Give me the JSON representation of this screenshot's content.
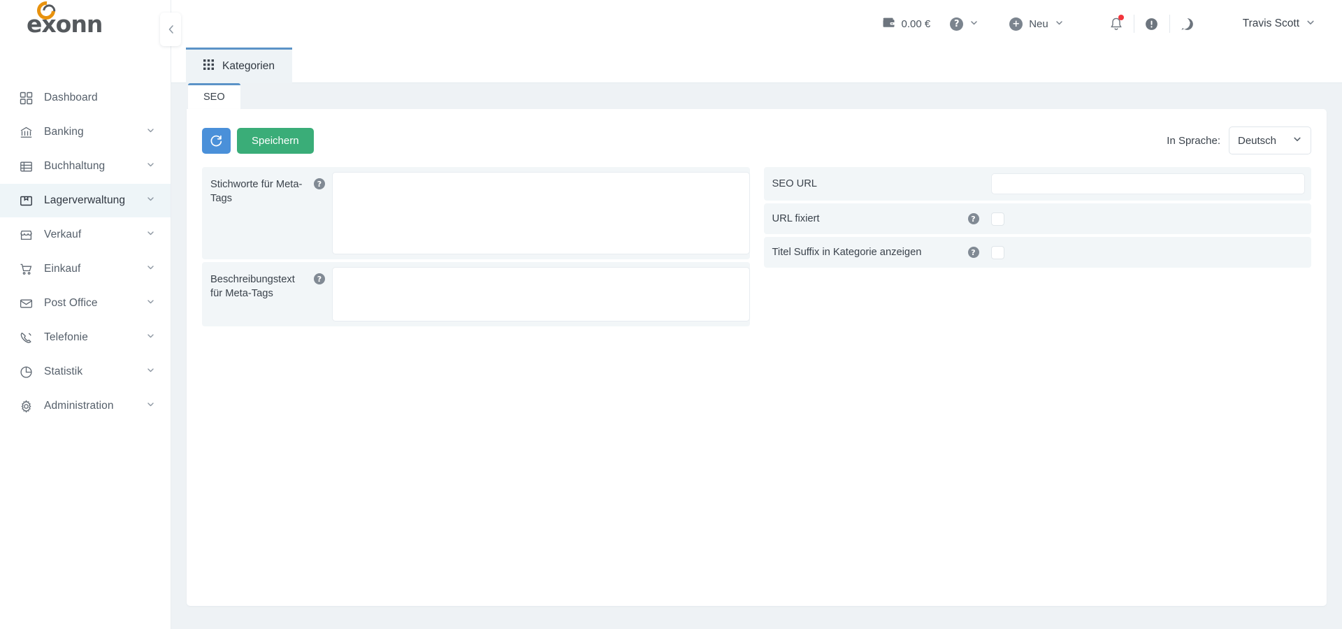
{
  "brand": {
    "logo_text": "exonn",
    "accent_color": "#e8920e"
  },
  "sidebar": {
    "collapse_icon": "chevron-left-icon",
    "items": [
      {
        "label": "Dashboard",
        "icon": "grid-icon",
        "has_chevron": false,
        "active": false
      },
      {
        "label": "Banking",
        "icon": "bank-icon",
        "has_chevron": true,
        "active": false
      },
      {
        "label": "Buchhaltung",
        "icon": "ledger-icon",
        "has_chevron": true,
        "active": false
      },
      {
        "label": "Lagerverwaltung",
        "icon": "box-icon",
        "has_chevron": true,
        "active": true
      },
      {
        "label": "Verkauf",
        "icon": "store-icon",
        "has_chevron": true,
        "active": false
      },
      {
        "label": "Einkauf",
        "icon": "cart-icon",
        "has_chevron": true,
        "active": false
      },
      {
        "label": "Post Office",
        "icon": "envelope-icon",
        "has_chevron": true,
        "active": false
      },
      {
        "label": "Telefonie",
        "icon": "phone-icon",
        "has_chevron": true,
        "active": false
      },
      {
        "label": "Statistik",
        "icon": "pie-chart-icon",
        "has_chevron": true,
        "active": false
      },
      {
        "label": "Administration",
        "icon": "gear-icon",
        "has_chevron": true,
        "active": false
      }
    ]
  },
  "header": {
    "balance": {
      "icon": "wallet-icon",
      "value": "0.00 €"
    },
    "help": {
      "icon": "question-circle-icon",
      "chevron": "chevron-down-icon"
    },
    "new": {
      "icon": "plus-circle-icon",
      "label": "Neu",
      "chevron": "chevron-down-icon"
    },
    "notifications": {
      "icon": "bell-icon",
      "has_badge": true,
      "badge_color": "#f2353c"
    },
    "alerts": {
      "icon": "exclamation-circle-icon"
    },
    "messages": {
      "icon": "chat-circle-icon"
    },
    "user": {
      "name": "Travis Scott",
      "chevron": "chevron-down-icon"
    }
  },
  "tabbar": {
    "tabs": [
      {
        "label": "Kategorien",
        "icon": "grid-3x3-icon",
        "active": true
      }
    ]
  },
  "subtabs": {
    "tabs": [
      {
        "label": "SEO",
        "active": true
      }
    ]
  },
  "toolbar": {
    "refresh": {
      "icon": "refresh-icon",
      "color": "#4a90d9"
    },
    "save_label": "Speichern",
    "save_color": "#3aad78",
    "language_label": "In Sprache:",
    "language_value": "Deutsch",
    "language_chevron": "chevron-down-icon"
  },
  "form": {
    "left": [
      {
        "label": "Stichworte für Meta-Tags",
        "help": "?",
        "control": "textarea",
        "value": "",
        "placeholder": ""
      },
      {
        "label": "Beschreibungstext für Meta-Tags",
        "help": "?",
        "control": "textarea",
        "value": "",
        "placeholder": ""
      }
    ],
    "right": [
      {
        "label": "SEO URL",
        "help": null,
        "control": "text",
        "value": "",
        "placeholder": ""
      },
      {
        "label": "URL fixiert",
        "help": "?",
        "control": "checkbox",
        "checked": false
      },
      {
        "label": "Titel Suffix in Kategorie anzeigen",
        "help": "?",
        "control": "checkbox",
        "checked": false
      }
    ]
  }
}
